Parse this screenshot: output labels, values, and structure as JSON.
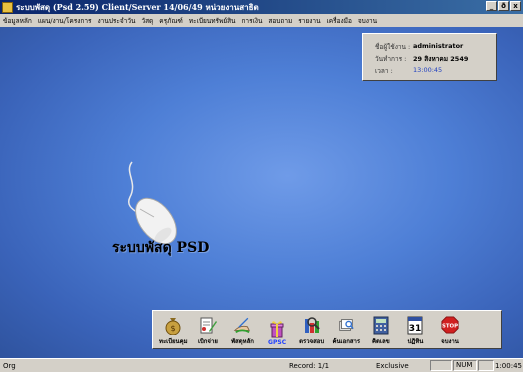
{
  "window": {
    "title": "ระบบพัสดุ (Psd 2.59) Client/Server 14/06/49 หน่วยงานสาธิต",
    "buttons": [
      "_",
      "ð",
      "x"
    ]
  },
  "menu": [
    "ข้อมูลหลัก",
    "แผน/งาน/โครงการ",
    "งานประจำวัน",
    "วัสดุ",
    "ครุภัณฑ์",
    "ทะเบียนทรัพย์สิน",
    "การเงิน",
    "สอบถาม",
    "รายงาน",
    "เครื่องมือ",
    "จบงาน"
  ],
  "info": {
    "user_label": "ชื่อผู้ใช้งาน :",
    "user_value": "administrator",
    "date_label": "วันทำการ :",
    "date_value": "29 สิงหาคม 2549",
    "time_label": "เวลา :",
    "time_value": "13:00:45"
  },
  "brand": "ระบบพัสดุ PSD",
  "toolbar": [
    {
      "label": "ทะเบียนคุม",
      "icon": "money-bag-icon"
    },
    {
      "label": "เบิกจ่าย",
      "icon": "document-pencil-icon"
    },
    {
      "label": "พัสดุหลัก",
      "icon": "hand-writing-icon"
    },
    {
      "label": "GPSC",
      "icon": "gift-icon"
    },
    {
      "label": "ตรวจสอบ",
      "icon": "magnifier-icon"
    },
    {
      "label": "ค้นเอกสาร",
      "icon": "document-search-icon"
    },
    {
      "label": "คิดเลข",
      "icon": "calculator-icon"
    },
    {
      "label": "ปฏิทิน",
      "icon": "calendar-icon"
    },
    {
      "label": "จบงาน",
      "icon": "stop-sign-icon"
    }
  ],
  "calendar_day": "31",
  "stop_text": "STOP",
  "status": {
    "left": "Org",
    "record": "Record: 1/1",
    "mode": "Exclusive",
    "num": "NUM",
    "time": "1:00:45"
  },
  "colors": {
    "title_start": "#0a246a",
    "title_end": "#3a6ea5",
    "desktop": "#4e7fd6",
    "gpsc_label": "#2040ff"
  }
}
